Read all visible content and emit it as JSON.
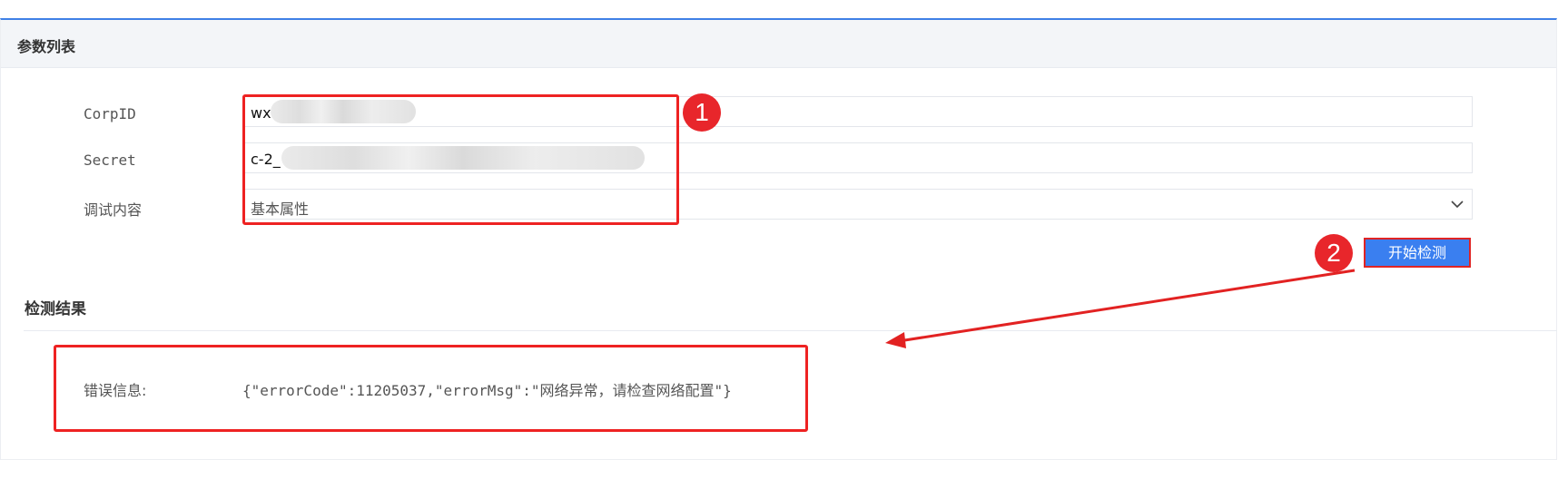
{
  "panel": {
    "title": "参数列表"
  },
  "form": {
    "corpid_label": "CorpID",
    "corpid_value": "wx",
    "secret_label": "Secret",
    "secret_value": "c-2_",
    "debug_label": "调试内容",
    "debug_selected": "基本属性"
  },
  "actions": {
    "start_label": "开始检测"
  },
  "result": {
    "section_title": "检测结果",
    "error_label": "错误信息:",
    "error_value": "{\"errorCode\":11205037,\"errorMsg\":\"网络异常，请检查网络配置\"}"
  },
  "annotations": {
    "badge_1": "1",
    "badge_2": "2"
  },
  "colors": {
    "accent": "#3a7ff0",
    "annotation_red": "#e22222",
    "header_bg": "#f3f5f8"
  },
  "icons": {
    "select_chevron": "chevron-down-icon"
  }
}
